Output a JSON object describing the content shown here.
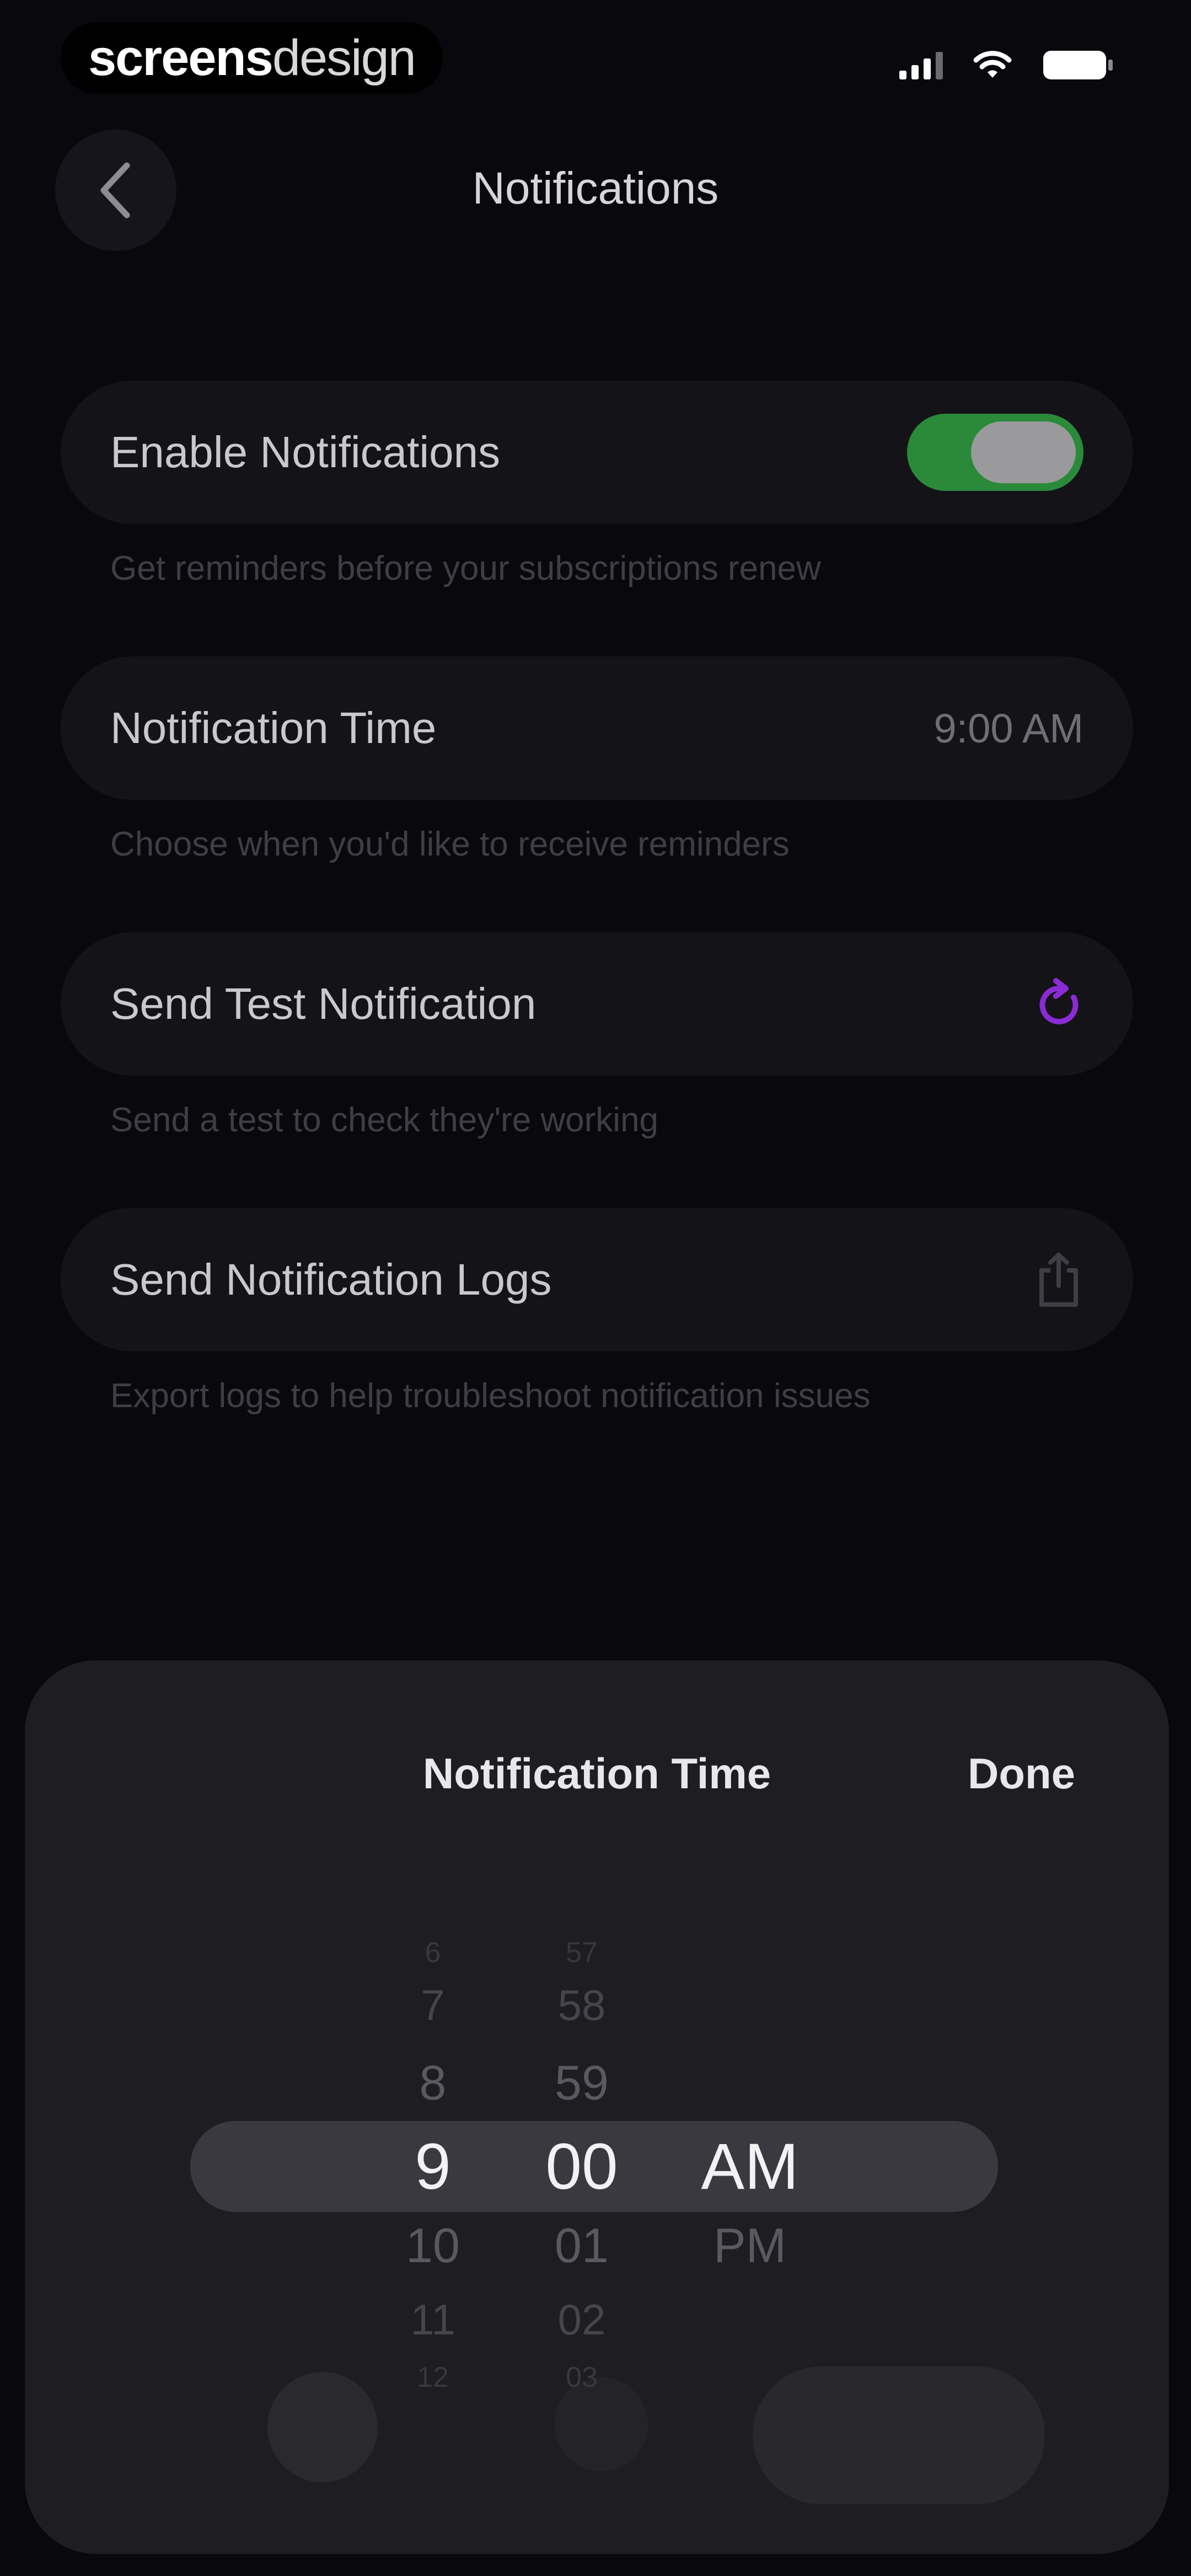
{
  "status_bar": {
    "watermark_bold": "screens",
    "watermark_light": "design"
  },
  "header": {
    "title": "Notifications"
  },
  "settings": {
    "enable": {
      "label": "Enable Notifications",
      "caption": "Get reminders before your subscriptions renew",
      "toggle_on": true
    },
    "time": {
      "label": "Notification Time",
      "value": "9:00 AM",
      "caption": "Choose when you'd like to receive reminders"
    },
    "test": {
      "label": "Send Test Notification",
      "caption": "Send a test to check they're working",
      "icon": "refresh-icon"
    },
    "logs": {
      "label": "Send Notification Logs",
      "caption": "Export logs to help troubleshoot notification issues",
      "icon": "share-icon"
    }
  },
  "sheet": {
    "title": "Notification Time",
    "done_label": "Done"
  },
  "picker": {
    "hours": [
      "6",
      "7",
      "8",
      "9",
      "10",
      "11",
      "12"
    ],
    "minutes": [
      "57",
      "58",
      "59",
      "00",
      "01",
      "02",
      "03"
    ],
    "periods": [
      "AM",
      "PM"
    ],
    "selected_hour": "9",
    "selected_minute": "00",
    "selected_period": "AM"
  },
  "colors": {
    "background": "#09080d",
    "row": "#141318",
    "toggle_on": "#2a8a3a",
    "accent_purple": "#8a2bd6",
    "sheet": "#1e1d22"
  }
}
